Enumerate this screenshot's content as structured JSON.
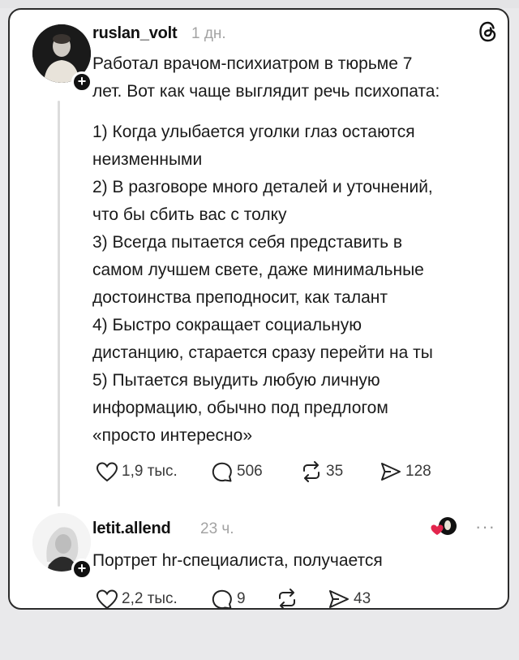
{
  "post1": {
    "username": "ruslan_volt",
    "time": "1 дн.",
    "lines": [
      "Работал врачом-психиатром в тюрьме 7",
      "лет. Вот как чаще выглядит речь психопата:"
    ],
    "items": [
      [
        "1) Когда улыбается уголки глаз остаются",
        "неизменными"
      ],
      [
        "2) В разговоре много деталей и уточнений,",
        "что бы сбить вас с толку"
      ],
      [
        "3) Всегда пытается себя представить в",
        "самом лучшем свете, даже минимальные",
        "достоинства преподносит, как талант"
      ],
      [
        "4) Быстро сокращает социальную",
        "дистанцию, старается сразу перейти на ты"
      ],
      [
        "5) Пытается выудить любую личную",
        "информацию, обычно под предлогом",
        "«просто интересно»"
      ]
    ],
    "likes": "1,9 тыс.",
    "comments": "506",
    "reposts": "35",
    "shares": "128",
    "logo_icon": "threads-icon"
  },
  "post2": {
    "username": "letit.allend",
    "time": "23 ч.",
    "text": "Портрет hr-специалиста, получается",
    "likes": "2,2 тыс.",
    "comments": "9",
    "reposts": "",
    "shares": "43",
    "more": "···"
  },
  "icons": {
    "like": "heart-icon",
    "comment": "comment-icon",
    "repost": "repost-icon",
    "share": "send-icon",
    "badge": "plus-icon"
  }
}
